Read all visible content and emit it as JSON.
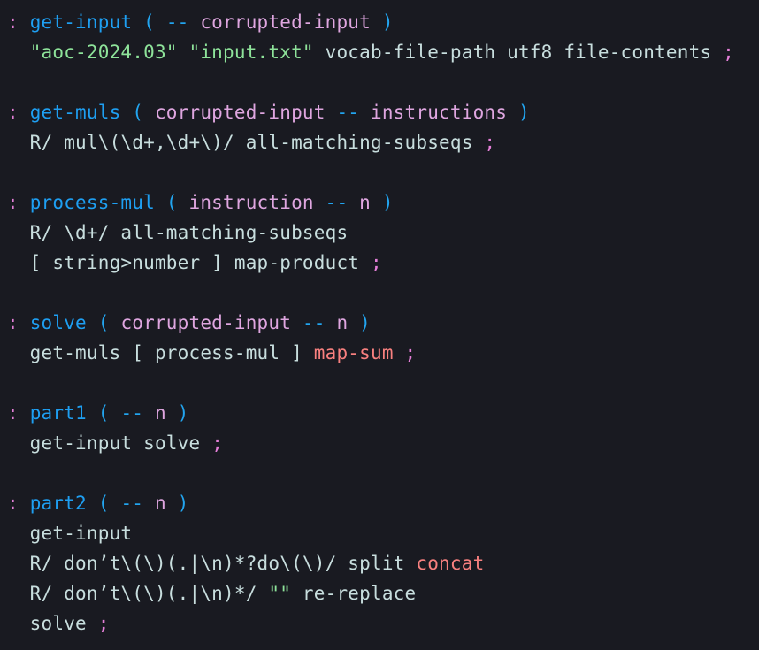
{
  "editor": {
    "kind": "source-code-view",
    "language": "Factor",
    "background_color": "#191a21",
    "default_text_color": "#c8dede",
    "font_size_px": 21,
    "line_height_px": 34
  },
  "colors": {
    "definition_delimiter": "#e47fd8",
    "definition_name": "#1e9ff2",
    "paren_and_arrow": "#22a5f0",
    "stack_effect_var": "#dfa6e0",
    "string_literal": "#8ee39a",
    "plain_word": "#c8dede",
    "accent_word": "#f8807f"
  },
  "lines": [
    {
      "id": "line-1",
      "tokens": [
        {
          "text": ":",
          "style": "t-def"
        },
        {
          "text": " ",
          "style": "t-word"
        },
        {
          "text": "get-input",
          "style": "t-name"
        },
        {
          "text": " ",
          "style": "t-word"
        },
        {
          "text": "(",
          "style": "t-paren"
        },
        {
          "text": " ",
          "style": "t-word"
        },
        {
          "text": "--",
          "style": "t-paren"
        },
        {
          "text": " ",
          "style": "t-word"
        },
        {
          "text": "corrupted-input",
          "style": "t-stack"
        },
        {
          "text": " ",
          "style": "t-word"
        },
        {
          "text": ")",
          "style": "t-paren"
        }
      ]
    },
    {
      "id": "line-2",
      "tokens": [
        {
          "text": "  ",
          "style": "t-word"
        },
        {
          "text": "\"aoc-2024.03\"",
          "style": "t-string"
        },
        {
          "text": " ",
          "style": "t-word"
        },
        {
          "text": "\"input.txt\"",
          "style": "t-string"
        },
        {
          "text": " vocab-file-path utf8 file-contents ",
          "style": "t-word"
        },
        {
          "text": ";",
          "style": "t-def"
        }
      ]
    },
    {
      "id": "line-3",
      "blank": true,
      "tokens": []
    },
    {
      "id": "line-4",
      "tokens": [
        {
          "text": ":",
          "style": "t-def"
        },
        {
          "text": " ",
          "style": "t-word"
        },
        {
          "text": "get-muls",
          "style": "t-name"
        },
        {
          "text": " ",
          "style": "t-word"
        },
        {
          "text": "(",
          "style": "t-paren"
        },
        {
          "text": " ",
          "style": "t-word"
        },
        {
          "text": "corrupted-input",
          "style": "t-stack"
        },
        {
          "text": " ",
          "style": "t-word"
        },
        {
          "text": "--",
          "style": "t-paren"
        },
        {
          "text": " ",
          "style": "t-word"
        },
        {
          "text": "instructions",
          "style": "t-stack"
        },
        {
          "text": " ",
          "style": "t-word"
        },
        {
          "text": ")",
          "style": "t-paren"
        }
      ]
    },
    {
      "id": "line-5",
      "tokens": [
        {
          "text": "  R/ mul\\(\\d+,\\d+\\)/ all-matching-subseqs ",
          "style": "t-word"
        },
        {
          "text": ";",
          "style": "t-def"
        }
      ]
    },
    {
      "id": "line-6",
      "blank": true,
      "tokens": []
    },
    {
      "id": "line-7",
      "tokens": [
        {
          "text": ":",
          "style": "t-def"
        },
        {
          "text": " ",
          "style": "t-word"
        },
        {
          "text": "process-mul",
          "style": "t-name"
        },
        {
          "text": " ",
          "style": "t-word"
        },
        {
          "text": "(",
          "style": "t-paren"
        },
        {
          "text": " ",
          "style": "t-word"
        },
        {
          "text": "instruction",
          "style": "t-stack"
        },
        {
          "text": " ",
          "style": "t-word"
        },
        {
          "text": "--",
          "style": "t-paren"
        },
        {
          "text": " ",
          "style": "t-word"
        },
        {
          "text": "n",
          "style": "t-stack"
        },
        {
          "text": " ",
          "style": "t-word"
        },
        {
          "text": ")",
          "style": "t-paren"
        }
      ]
    },
    {
      "id": "line-8",
      "tokens": [
        {
          "text": "  R/ \\d+/ all-matching-subseqs",
          "style": "t-word"
        }
      ]
    },
    {
      "id": "line-9",
      "tokens": [
        {
          "text": "  [ string>number ] map-product ",
          "style": "t-word"
        },
        {
          "text": ";",
          "style": "t-def"
        }
      ]
    },
    {
      "id": "line-10",
      "blank": true,
      "tokens": []
    },
    {
      "id": "line-11",
      "tokens": [
        {
          "text": ":",
          "style": "t-def"
        },
        {
          "text": " ",
          "style": "t-word"
        },
        {
          "text": "solve",
          "style": "t-name"
        },
        {
          "text": " ",
          "style": "t-word"
        },
        {
          "text": "(",
          "style": "t-paren"
        },
        {
          "text": " ",
          "style": "t-word"
        },
        {
          "text": "corrupted-input",
          "style": "t-stack"
        },
        {
          "text": " ",
          "style": "t-word"
        },
        {
          "text": "--",
          "style": "t-paren"
        },
        {
          "text": " ",
          "style": "t-word"
        },
        {
          "text": "n",
          "style": "t-stack"
        },
        {
          "text": " ",
          "style": "t-word"
        },
        {
          "text": ")",
          "style": "t-paren"
        }
      ]
    },
    {
      "id": "line-12",
      "tokens": [
        {
          "text": "  get-muls [ process-mul ] ",
          "style": "t-word"
        },
        {
          "text": "map-sum",
          "style": "t-accent"
        },
        {
          "text": " ",
          "style": "t-word"
        },
        {
          "text": ";",
          "style": "t-def"
        }
      ]
    },
    {
      "id": "line-13",
      "blank": true,
      "tokens": []
    },
    {
      "id": "line-14",
      "tokens": [
        {
          "text": ":",
          "style": "t-def"
        },
        {
          "text": " ",
          "style": "t-word"
        },
        {
          "text": "part1",
          "style": "t-name"
        },
        {
          "text": " ",
          "style": "t-word"
        },
        {
          "text": "(",
          "style": "t-paren"
        },
        {
          "text": " ",
          "style": "t-word"
        },
        {
          "text": "--",
          "style": "t-paren"
        },
        {
          "text": " ",
          "style": "t-word"
        },
        {
          "text": "n",
          "style": "t-stack"
        },
        {
          "text": " ",
          "style": "t-word"
        },
        {
          "text": ")",
          "style": "t-paren"
        }
      ]
    },
    {
      "id": "line-15",
      "tokens": [
        {
          "text": "  get-input solve ",
          "style": "t-word"
        },
        {
          "text": ";",
          "style": "t-def"
        }
      ]
    },
    {
      "id": "line-16",
      "blank": true,
      "tokens": []
    },
    {
      "id": "line-17",
      "tokens": [
        {
          "text": ":",
          "style": "t-def"
        },
        {
          "text": " ",
          "style": "t-word"
        },
        {
          "text": "part2",
          "style": "t-name"
        },
        {
          "text": " ",
          "style": "t-word"
        },
        {
          "text": "(",
          "style": "t-paren"
        },
        {
          "text": " ",
          "style": "t-word"
        },
        {
          "text": "--",
          "style": "t-paren"
        },
        {
          "text": " ",
          "style": "t-word"
        },
        {
          "text": "n",
          "style": "t-stack"
        },
        {
          "text": " ",
          "style": "t-word"
        },
        {
          "text": ")",
          "style": "t-paren"
        }
      ]
    },
    {
      "id": "line-18",
      "tokens": [
        {
          "text": "  get-input",
          "style": "t-word"
        }
      ]
    },
    {
      "id": "line-19",
      "tokens": [
        {
          "text": "  R/ don’t\\(\\)(.|\\n)*?do\\(\\)/ split ",
          "style": "t-word"
        },
        {
          "text": "concat",
          "style": "t-accent"
        }
      ]
    },
    {
      "id": "line-20",
      "tokens": [
        {
          "text": "  R/ don’t\\(\\)(.|\\n)*/ ",
          "style": "t-word"
        },
        {
          "text": "\"\"",
          "style": "t-string"
        },
        {
          "text": " re-replace",
          "style": "t-word"
        }
      ]
    },
    {
      "id": "line-21",
      "tokens": [
        {
          "text": "  solve ",
          "style": "t-word"
        },
        {
          "text": ";",
          "style": "t-def"
        }
      ]
    }
  ]
}
